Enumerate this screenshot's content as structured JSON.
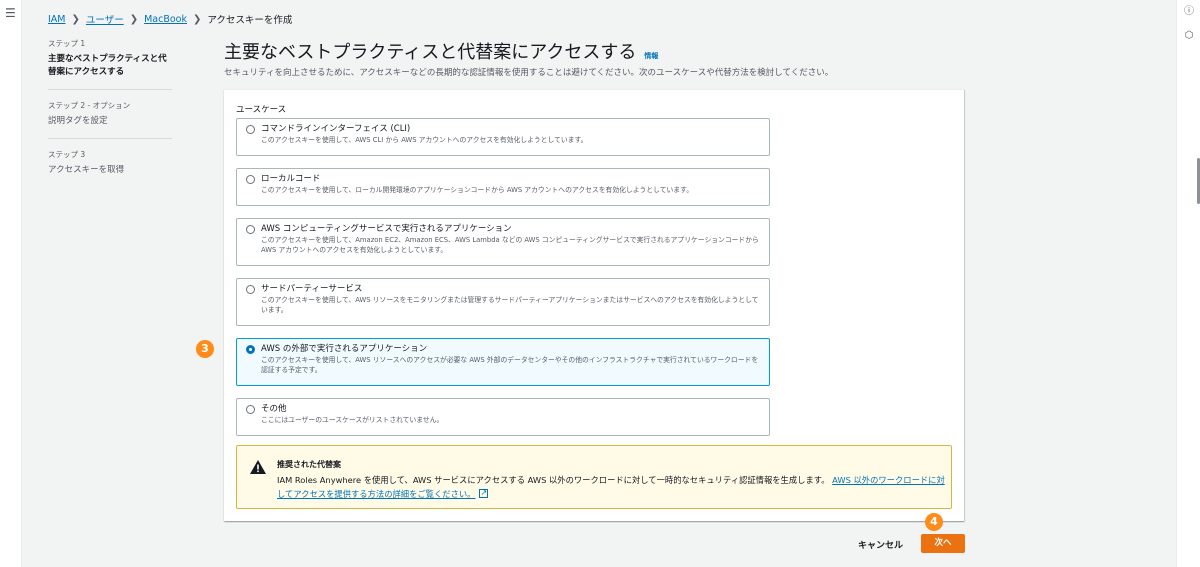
{
  "nav": {
    "menu_icon": "hamburger-icon"
  },
  "breadcrumb": [
    {
      "label": "IAM",
      "link": true
    },
    {
      "label": "ユーザー",
      "link": true
    },
    {
      "label": "MacBook",
      "link": true
    },
    {
      "label": "アクセスキーを作成",
      "link": false
    }
  ],
  "steps": [
    {
      "num": "ステップ 1",
      "title": "主要なベストプラクティスと代替案にアクセスする",
      "active": true
    },
    {
      "num": "ステップ 2 - オプション",
      "title": "説明タグを設定",
      "active": false
    },
    {
      "num": "ステップ 3",
      "title": "アクセスキーを取得",
      "active": false
    }
  ],
  "page": {
    "title": "主要なベストプラクティスと代替案にアクセスする",
    "info": "情報",
    "description": "セキュリティを向上させるために、アクセスキーなどの長期的な認証情報を使用することは避けてください。次のユースケースや代替方法を検討してください。"
  },
  "usecase": {
    "label": "ユースケース",
    "options": [
      {
        "title": "コマンドラインインターフェイス (CLI)",
        "desc": "このアクセスキーを使用して、AWS CLI から AWS アカウントへのアクセスを有効化しようとしています。",
        "selected": false
      },
      {
        "title": "ローカルコード",
        "desc": "このアクセスキーを使用して、ローカル開発環境のアプリケーションコードから AWS アカウントへのアクセスを有効化しようとしています。",
        "selected": false
      },
      {
        "title": "AWS コンピューティングサービスで実行されるアプリケーション",
        "desc": "このアクセスキーを使用して、Amazon EC2、Amazon ECS、AWS Lambda などの AWS コンピューティングサービスで実行されるアプリケーションコードから AWS アカウントへのアクセスを有効化しようとしています。",
        "selected": false
      },
      {
        "title": "サードパーティーサービス",
        "desc": "このアクセスキーを使用して、AWS リソースをモニタリングまたは管理するサードパーティーアプリケーションまたはサービスへのアクセスを有効化しようとしています。",
        "selected": false
      },
      {
        "title": "AWS の外部で実行されるアプリケーション",
        "desc": "このアクセスキーを使用して、AWS リソースへのアクセスが必要な AWS 外部のデータセンターやその他のインフラストラクチャで実行されているワークロードを認証する予定です。",
        "selected": true
      },
      {
        "title": "その他",
        "desc": "ここにはユーザーのユースケースがリストされていません。",
        "selected": false
      }
    ]
  },
  "alert": {
    "icon": "warning-icon",
    "title": "推奨された代替案",
    "body": "IAM Roles Anywhere を使用して、AWS サービスにアクセスする AWS 以外のワークロードに対して一時的なセキュリティ認証情報を生成します。",
    "link": "AWS 以外のワークロードに対してアクセスを提供する方法の詳細をご覧ください。",
    "link_icon": "external-link-icon"
  },
  "annotations": {
    "badge_3": "3",
    "badge_4": "4"
  },
  "footer": {
    "cancel": "キャンセル",
    "next": "次へ"
  },
  "colors": {
    "primary": "#ec7211",
    "link": "#0073bb",
    "badge": "#ff8c1a",
    "selected_bg": "#f1faff",
    "warning_bg": "#fffbe6"
  }
}
